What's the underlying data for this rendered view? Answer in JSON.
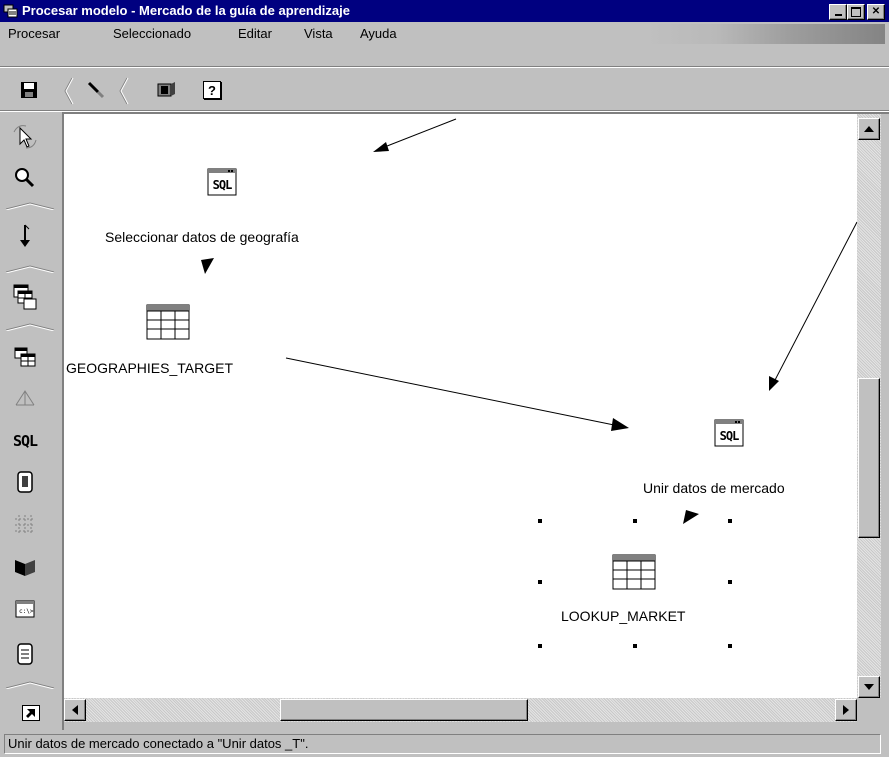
{
  "window": {
    "title": "Procesar modelo - Mercado de la guía de aprendizaje",
    "controls": [
      "minimize",
      "maximize",
      "close"
    ]
  },
  "menu": {
    "items": [
      "Procesar",
      "Seleccionado",
      "Editar",
      "Vista",
      "Ayuda"
    ]
  },
  "toolbar": {
    "icons": [
      "save-icon",
      "link-tool-icon",
      "run-icon",
      "help-icon"
    ],
    "help_label": "?"
  },
  "palette": {
    "icons": [
      "select-arrow-icon",
      "zoom-icon",
      "task-flow-icon",
      "source-tables-icon",
      "target-table-icon",
      "transformer-icon",
      "sql-step-icon",
      "program-icon",
      "grid-icon",
      "cube-icon",
      "file-icon",
      "text-file-icon",
      "shortcut-icon"
    ],
    "sql_label": "SQL"
  },
  "canvas": {
    "nodes": [
      {
        "label": "Seleccionar datos de geografía",
        "type": "sql-step",
        "icon_text": "SQL"
      },
      {
        "label": "GEOGRAPHIES_TARGET",
        "type": "target-table"
      },
      {
        "label": "Unir datos de mercado",
        "type": "sql-step",
        "icon_text": "SQL"
      },
      {
        "label": "LOOKUP_MARKET",
        "type": "table",
        "selected": true
      }
    ]
  },
  "status_bar": {
    "text": "Unir datos de mercado conectado a \"Unir datos _T\"."
  }
}
